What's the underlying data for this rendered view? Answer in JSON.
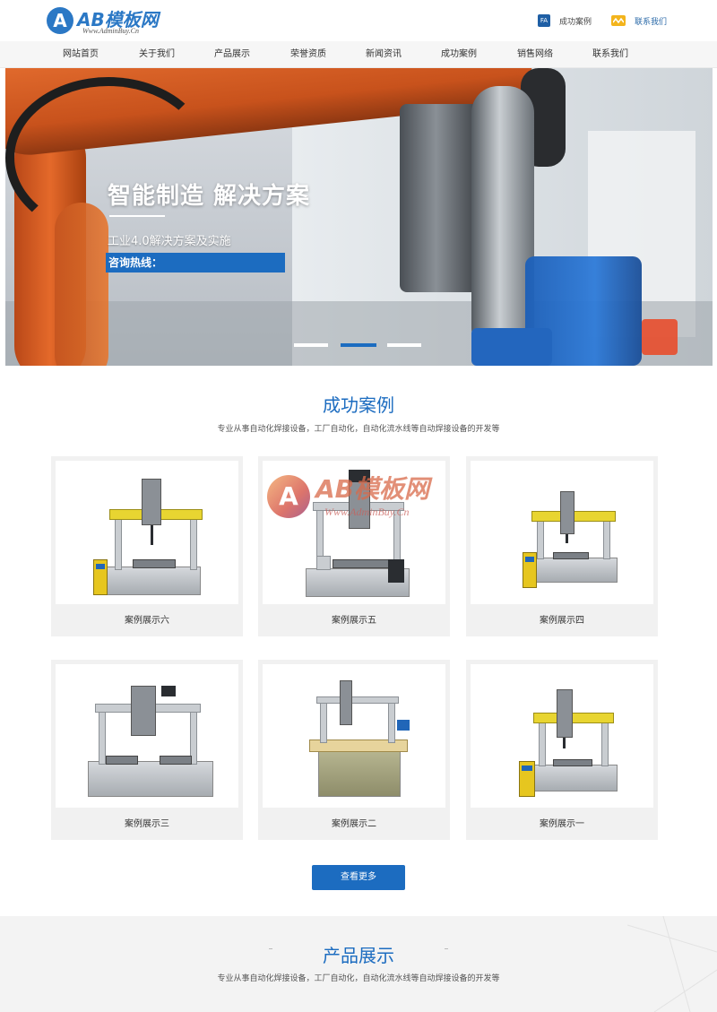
{
  "header": {
    "logo_letter": "A",
    "logo_name": "AB模板网",
    "logo_url_text": "Www.AdminBuy.Cn",
    "fa_badge": "FA",
    "top_links": [
      "成功案例",
      "联系我们"
    ]
  },
  "nav": {
    "items": [
      "网站首页",
      "关于我们",
      "产品展示",
      "荣誉资质",
      "新闻资讯",
      "成功案例",
      "销售网络",
      "联系我们"
    ]
  },
  "banner": {
    "title": "智能制造 解决方案",
    "subtitle": "工业4.0解决方案及实施",
    "hotline_label": "咨询热线："
  },
  "cases_section": {
    "title": "成功案例",
    "description": "专业从事自动化焊接设备，工厂自动化，自动化流水线等自动焊接设备的开发等",
    "items": [
      {
        "label": "案例展示六"
      },
      {
        "label": "案例展示五"
      },
      {
        "label": "案例展示四"
      },
      {
        "label": "案例展示三"
      },
      {
        "label": "案例展示二"
      },
      {
        "label": "案例展示一"
      }
    ],
    "more_button": "查看更多"
  },
  "watermark": {
    "letter": "A",
    "name": "AB模板网",
    "url": "Www.AdminBuy.Cn"
  },
  "products_section": {
    "title": "产品展示",
    "description": "专业从事自动化焊接设备，工厂自动化，自动化流水线等自动焊接设备的开发等"
  },
  "colors": {
    "accent": "#1c6cc0",
    "logo_blue": "#2b78c5",
    "banner_orange": "#e46d2f",
    "machine_yellow": "#e8d531"
  }
}
